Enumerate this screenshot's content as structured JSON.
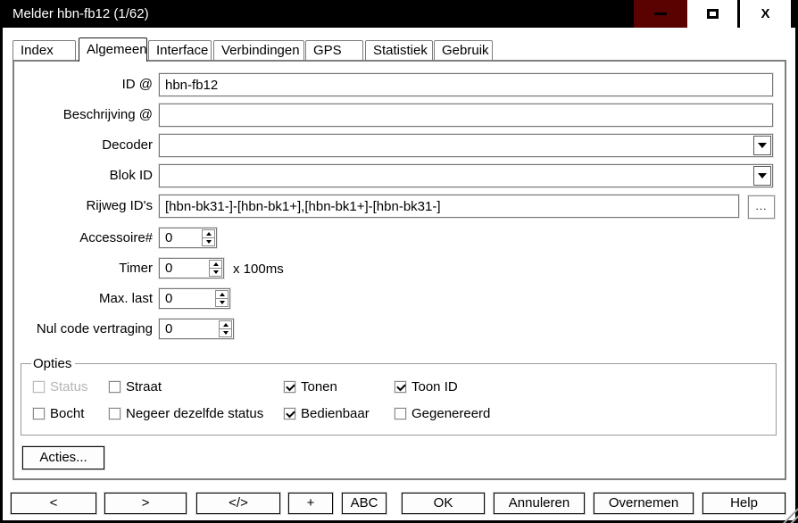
{
  "window": {
    "title": "Melder hbn-fb12 (1/62)",
    "close_glyph": "X"
  },
  "tabs": [
    {
      "label": "Index",
      "active": false
    },
    {
      "label": "Algemeen",
      "active": true
    },
    {
      "label": "Interface",
      "active": false
    },
    {
      "label": "Verbindingen",
      "active": false
    },
    {
      "label": "GPS",
      "active": false
    },
    {
      "label": "Statistiek",
      "active": false
    },
    {
      "label": "Gebruik",
      "active": false
    }
  ],
  "form": {
    "id": {
      "label": "ID @",
      "value": "hbn-fb12"
    },
    "beschrijving": {
      "label": "Beschrijving @",
      "value": ""
    },
    "decoder": {
      "label": "Decoder",
      "value": ""
    },
    "blok_id": {
      "label": "Blok ID",
      "value": ""
    },
    "rijweg": {
      "label": "Rijweg ID's",
      "value": "[hbn-bk31-]-[hbn-bk1+],[hbn-bk1+]-[hbn-bk31-]",
      "browse_label": "..."
    },
    "accessoire": {
      "label": "Accessoire#",
      "value": "0"
    },
    "timer": {
      "label": "Timer",
      "value": "0",
      "suffix": "x 100ms"
    },
    "max_last": {
      "label": "Max. last",
      "value": "0"
    },
    "nul_code": {
      "label": "Nul code vertraging",
      "value": "0"
    }
  },
  "opties": {
    "title": "Opties",
    "items": [
      {
        "label": "Status",
        "checked": false,
        "disabled": true
      },
      {
        "label": "Straat",
        "checked": false,
        "disabled": false
      },
      {
        "label": "Tonen",
        "checked": true,
        "disabled": false
      },
      {
        "label": "Toon ID",
        "checked": true,
        "disabled": false
      },
      {
        "label": "Bocht",
        "checked": false,
        "disabled": false
      },
      {
        "label": "Negeer dezelfde status",
        "checked": false,
        "disabled": false
      },
      {
        "label": "Bedienbaar",
        "checked": true,
        "disabled": false
      },
      {
        "label": "Gegenereerd",
        "checked": false,
        "disabled": false
      }
    ]
  },
  "buttons": {
    "acties": "Acties...",
    "nav": [
      "<",
      ">",
      "</>",
      "+",
      "ABC"
    ],
    "actions": [
      "OK",
      "Annuleren",
      "Overnemen",
      "Help"
    ]
  },
  "colors": {
    "titlebar_bg": "#000000",
    "minimize_bg": "#5a0101",
    "disabled_text": "#b4b4b4"
  }
}
